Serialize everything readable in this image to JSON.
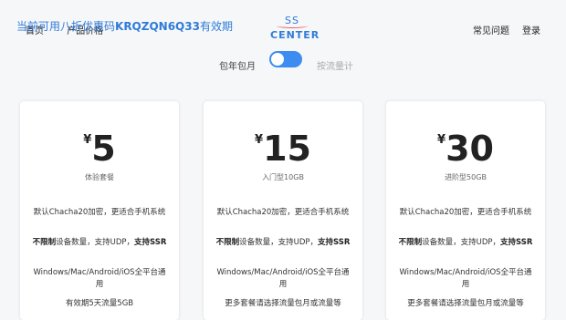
{
  "promo": {
    "text_before": "当前可用八折优惠码",
    "code": "KRQZQN6Q33",
    "text_after": "有效期"
  },
  "nav": {
    "home": "首页",
    "pricing": "产品价格",
    "faq": "常见问题",
    "login": "登录"
  },
  "logo": {
    "line1": "SS",
    "line2": "CENTER"
  },
  "billing": {
    "left_label": "包年包月",
    "right_label": "按流量计",
    "toggle_on": true
  },
  "plans": [
    {
      "currency": "¥",
      "price": "5",
      "subtitle": "体验套餐",
      "feature1": "默认Chacha20加密，更适合手机系统",
      "feature2_bold": "不限制",
      "feature2_rest": "设备数量，支持UDP，",
      "feature2_bold2": "支持SSR",
      "feature3": "Windows/Mac/Android/iOS全平台通用",
      "feature4": "有效期5天流量5GB"
    },
    {
      "currency": "¥",
      "price": "15",
      "subtitle": "入门型10GB",
      "feature1": "默认Chacha20加密，更适合手机系统",
      "feature2_bold": "不限制",
      "feature2_rest": "设备数量，支持UDP，",
      "feature2_bold2": "支持SSR",
      "feature3": "Windows/Mac/Android/iOS全平台通用",
      "feature4": "更多套餐请选择流量包月或流量等"
    },
    {
      "currency": "¥",
      "price": "30",
      "subtitle": "进阶型50GB",
      "feature1": "默认Chacha20加密，更适合手机系统",
      "feature2_bold": "不限制",
      "feature2_rest": "设备数量，支持UDP，",
      "feature2_bold2": "支持SSR",
      "feature3": "Windows/Mac/Android/iOS全平台通用",
      "feature4": "更多套餐请选择流量包月或流量等"
    }
  ],
  "colors": {
    "accent": "#2f7bd8",
    "toggle": "#3d8cf0",
    "background": "#f6f7f9"
  }
}
